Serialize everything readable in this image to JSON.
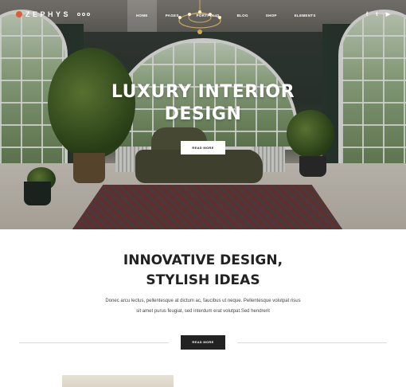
{
  "header": {
    "logo_text": "ZEPHYS",
    "nav": [
      {
        "label": "HOME",
        "active": true
      },
      {
        "label": "PAGES",
        "active": false
      },
      {
        "label": "PORTFOLIO",
        "active": false
      },
      {
        "label": "BLOG",
        "active": false
      },
      {
        "label": "SHOP",
        "active": false
      },
      {
        "label": "ELEMENTS",
        "active": false
      }
    ],
    "social": [
      {
        "icon": "facebook-icon",
        "glyph": "f"
      },
      {
        "icon": "twitter-icon",
        "glyph": "t"
      },
      {
        "icon": "youtube-icon",
        "glyph": "▶"
      }
    ]
  },
  "hero": {
    "title_line1": "LUXURY INTERIOR",
    "title_line2": "DESIGN",
    "button_label": "READ MORE"
  },
  "intro": {
    "title_line1": "INNOVATIVE DESIGN,",
    "title_line2": "STYLISH IDEAS",
    "text_line1": "Donec arcu lectus, pellentesque at dictum ac, faucibus ut neque. Pellentesque volutpat risus",
    "text_line2": "sit amet purus feugiat, sed interdum erat volutpat.Sed hendrerit",
    "button_label": "READ MORE"
  },
  "colors": {
    "accent": "#e05a3c",
    "dark_button": "#222222"
  }
}
